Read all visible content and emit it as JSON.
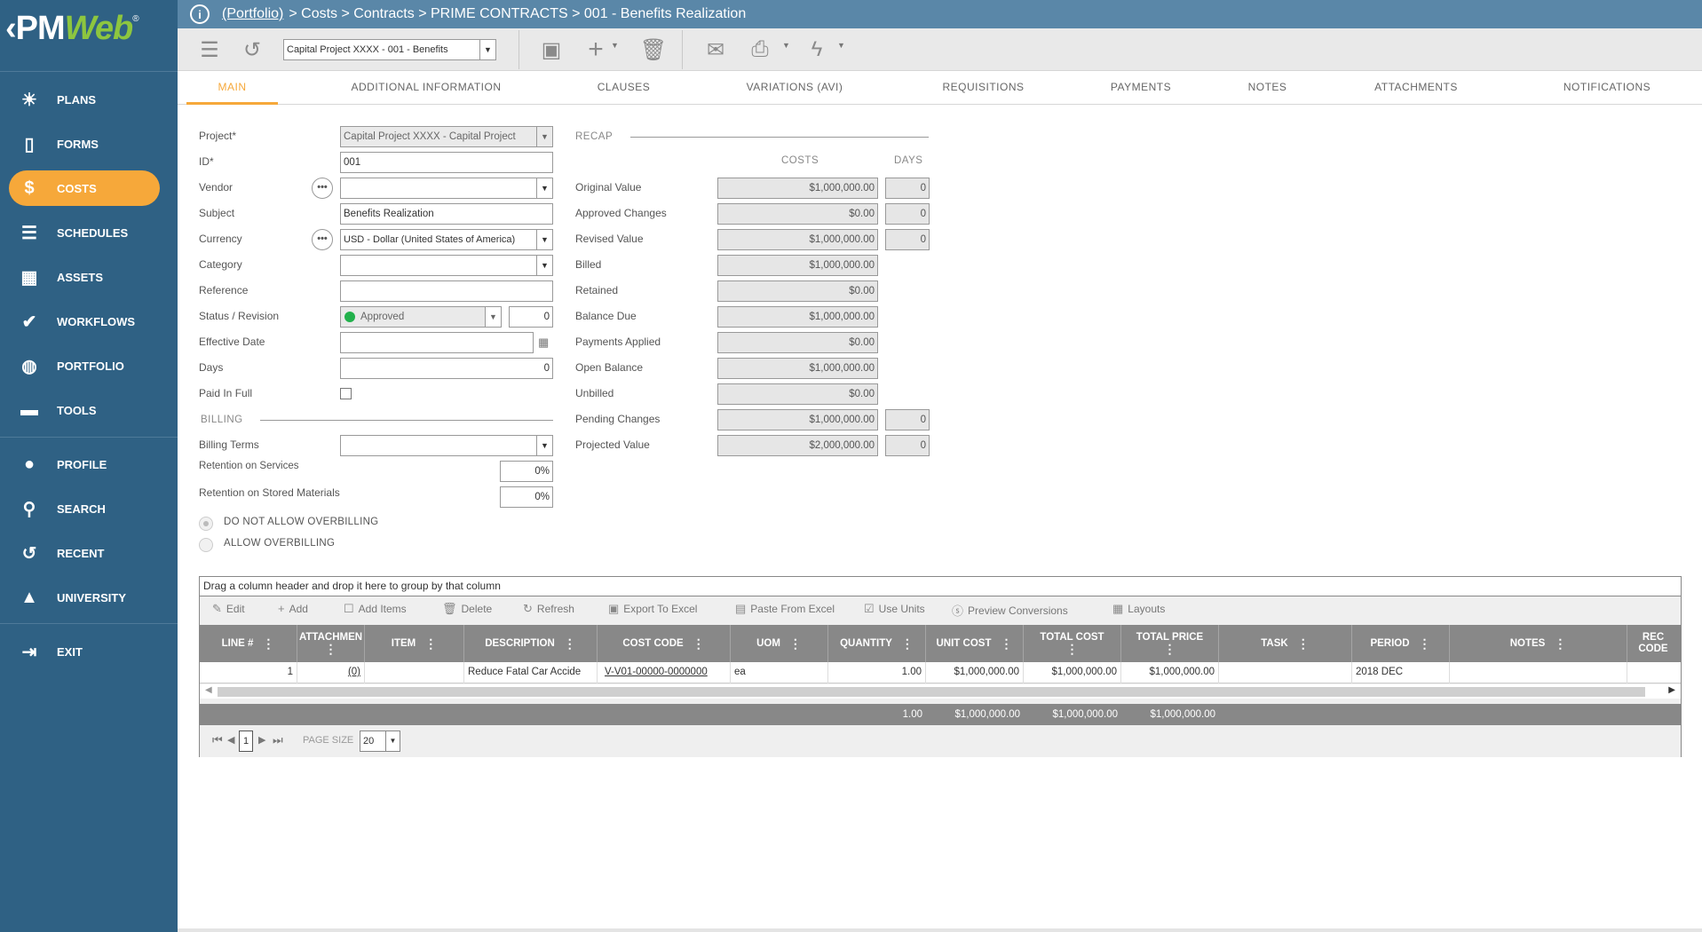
{
  "logo": {
    "text_a": "PM",
    "text_b": "Web",
    "reg": "®"
  },
  "nav": {
    "items": [
      {
        "label": "PLANS",
        "icon": "lightbulb-icon",
        "active": false
      },
      {
        "label": "FORMS",
        "icon": "forms-icon",
        "active": false
      },
      {
        "label": "COSTS",
        "icon": "dollar-icon",
        "active": true
      },
      {
        "label": "SCHEDULES",
        "icon": "schedules-icon",
        "active": false
      },
      {
        "label": "ASSETS",
        "icon": "building-icon",
        "active": false
      },
      {
        "label": "WORKFLOWS",
        "icon": "checkmark-icon",
        "active": false
      },
      {
        "label": "PORTFOLIO",
        "icon": "globe-icon",
        "active": false
      },
      {
        "label": "TOOLS",
        "icon": "toolbox-icon",
        "active": false
      }
    ],
    "user_items": [
      {
        "label": "PROFILE",
        "icon": "user-icon"
      },
      {
        "label": "SEARCH",
        "icon": "search-icon"
      },
      {
        "label": "RECENT",
        "icon": "history-icon"
      },
      {
        "label": "UNIVERSITY",
        "icon": "graduation-cap-icon"
      }
    ],
    "exit": {
      "label": "EXIT",
      "icon": "exit-icon"
    }
  },
  "breadcrumb": {
    "link": "(Portfolio)",
    "rest": "> Costs > Contracts > PRIME CONTRACTS > 001 - Benefits Realization"
  },
  "toolbar": {
    "record_select": "Capital Project XXXX - 001 - Benefits"
  },
  "tabs": [
    "MAIN",
    "ADDITIONAL INFORMATION",
    "CLAUSES",
    "VARIATIONS (AVI)",
    "REQUISITIONS",
    "PAYMENTS",
    "NOTES",
    "ATTACHMENTS",
    "NOTIFICATIONS"
  ],
  "form": {
    "project": {
      "label": "Project*",
      "value": "Capital Project XXXX - Capital Project"
    },
    "id": {
      "label": "ID*",
      "value": "001"
    },
    "vendor": {
      "label": "Vendor",
      "value": ""
    },
    "subject": {
      "label": "Subject",
      "value": "Benefits Realization"
    },
    "currency": {
      "label": "Currency",
      "value": "USD - Dollar (United States of America)"
    },
    "category": {
      "label": "Category",
      "value": ""
    },
    "reference": {
      "label": "Reference",
      "value": ""
    },
    "status": {
      "label": "Status / Revision",
      "value": "Approved",
      "revision": "0"
    },
    "effective_date": {
      "label": "Effective Date",
      "value": ""
    },
    "days": {
      "label": "Days",
      "value": "0"
    },
    "paid_in_full": {
      "label": "Paid In Full"
    },
    "billing_section": "BILLING",
    "billing_terms": {
      "label": "Billing Terms",
      "value": ""
    },
    "retention_services": {
      "label": "Retention on Services",
      "value": "0%"
    },
    "retention_materials": {
      "label": "Retention on Stored Materials",
      "value": "0%"
    },
    "overbilling": {
      "opt1": "DO NOT ALLOW OVERBILLING",
      "opt2": "ALLOW OVERBILLING"
    }
  },
  "recap": {
    "title": "RECAP",
    "col_costs": "COSTS",
    "col_days": "DAYS",
    "rows": [
      {
        "label": "Original Value",
        "cost": "$1,000,000.00",
        "days": "0"
      },
      {
        "label": "Approved Changes",
        "cost": "$0.00",
        "days": "0"
      },
      {
        "label": "Revised Value",
        "cost": "$1,000,000.00",
        "days": "0"
      },
      {
        "label": "Billed",
        "cost": "$1,000,000.00",
        "days": null
      },
      {
        "label": "Retained",
        "cost": "$0.00",
        "days": null
      },
      {
        "label": "Balance Due",
        "cost": "$1,000,000.00",
        "days": null
      },
      {
        "label": "Payments Applied",
        "cost": "$0.00",
        "days": null
      },
      {
        "label": "Open Balance",
        "cost": "$1,000,000.00",
        "days": null
      },
      {
        "label": "Unbilled",
        "cost": "$0.00",
        "days": null
      },
      {
        "label": "Pending Changes",
        "cost": "$1,000,000.00",
        "days": "0"
      },
      {
        "label": "Projected Value",
        "cost": "$2,000,000.00",
        "days": "0"
      }
    ]
  },
  "grid": {
    "group_hint": "Drag a column header and drop it here to group by that column",
    "toolbar": [
      "Edit",
      "Add",
      "Add Items",
      "Delete",
      "Refresh",
      "Export To Excel",
      "Paste From Excel",
      "Use Units",
      "Preview Conversions",
      "Layouts"
    ],
    "columns": [
      "LINE #",
      "ATTACHMEN",
      "ITEM",
      "DESCRIPTION",
      "COST CODE",
      "UOM",
      "QUANTITY",
      "UNIT COST",
      "TOTAL COST",
      "TOTAL PRICE",
      "TASK",
      "PERIOD",
      "NOTES",
      "REC CODE"
    ],
    "row": {
      "line": "1",
      "attach": "(0)",
      "item": "",
      "description": "Reduce Fatal Car Accide",
      "cost_code": "V-V01-00000-0000000",
      "uom": "ea",
      "quantity": "1.00",
      "unit_cost": "$1,000,000.00",
      "total_cost": "$1,000,000.00",
      "total_price": "$1,000,000.00",
      "task": "",
      "period": "2018 DEC",
      "notes": ""
    },
    "totals": {
      "quantity": "1.00",
      "unit_cost": "$1,000,000.00",
      "total_cost": "$1,000,000.00",
      "total_price": "$1,000,000.00"
    },
    "pager": {
      "page": "1",
      "page_size_label": "PAGE SIZE",
      "page_size": "20"
    }
  },
  "colors": {
    "sidebar": "#2f6184",
    "topbar": "#5a87a8",
    "accent": "#f6a83a",
    "status_green": "#22b14c"
  }
}
